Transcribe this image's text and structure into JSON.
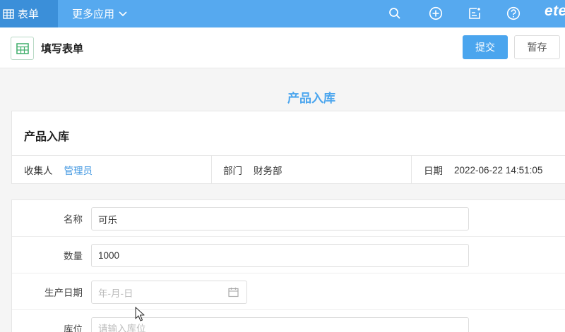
{
  "topbar": {
    "active_tab": "表单",
    "more_apps": "更多应用",
    "brand": "ete"
  },
  "header": {
    "title": "填写表单",
    "submit": "提交",
    "save": "暂存"
  },
  "form": {
    "heading": "产品入库",
    "card_title": "产品入库",
    "meta": {
      "collector_label": "收集人",
      "collector_value": "管理员",
      "dept_label": "部门",
      "dept_value": "财务部",
      "date_label": "日期",
      "date_value": "2022-06-22 14:51:05"
    },
    "fields": [
      {
        "label": "名称",
        "value": "可乐",
        "placeholder": ""
      },
      {
        "label": "数量",
        "value": "1000",
        "placeholder": ""
      },
      {
        "label": "生产日期",
        "value": "",
        "placeholder": "年-月-日"
      },
      {
        "label": "库位",
        "value": "",
        "placeholder": "请输入库位"
      }
    ]
  },
  "colors": {
    "topbar": "#56a9ef",
    "topbar_active": "#3b8fd9",
    "accent": "#4aa5ee",
    "link": "#3d95e0"
  },
  "icons": [
    "table-icon",
    "chevron-down-icon",
    "search-icon",
    "plus-circle-icon",
    "note-icon",
    "help-icon",
    "form-table-icon",
    "calendar-icon",
    "mouse-cursor-icon"
  ]
}
